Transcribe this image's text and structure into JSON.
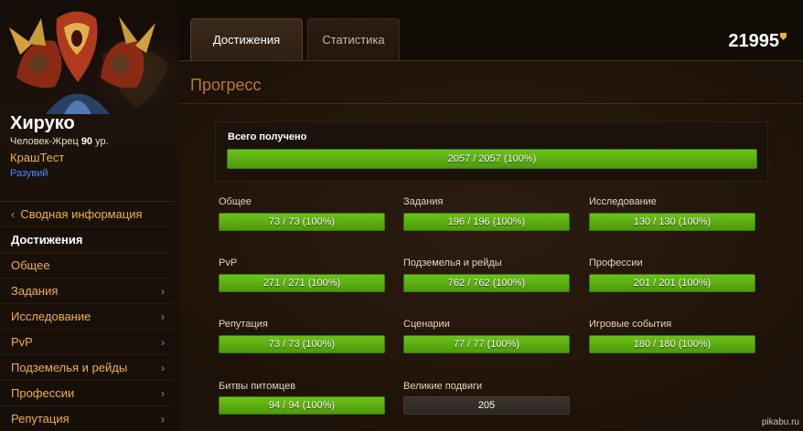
{
  "character": {
    "name": "Хируко",
    "race_class": "Человек-Жрец",
    "level": "90",
    "level_suffix": "ур.",
    "realm": "КрашТест",
    "guild": "Разувий"
  },
  "points": {
    "value": "21995",
    "icon": "shield-points-icon"
  },
  "tabs": [
    {
      "label": "Достижения",
      "active": true
    },
    {
      "label": "Статистика",
      "active": false
    }
  ],
  "sidebar": {
    "items": [
      {
        "label": "Сводная информация",
        "icon": "chevron-left-icon"
      },
      {
        "label": "Достижения",
        "active": true
      },
      {
        "label": "Общее"
      },
      {
        "label": "Задания",
        "icon": "chevron-right-icon"
      },
      {
        "label": "Исследование",
        "icon": "chevron-right-icon"
      },
      {
        "label": "PvP",
        "icon": "chevron-right-icon"
      },
      {
        "label": "Подземелья и рейды",
        "icon": "chevron-right-icon"
      },
      {
        "label": "Профессии",
        "icon": "chevron-right-icon"
      },
      {
        "label": "Репутация",
        "icon": "chevron-right-icon"
      }
    ]
  },
  "main": {
    "title": "Прогресс",
    "total": {
      "label": "Всего получено",
      "value": "2057 / 2057 (100%)",
      "progress": 1.0
    },
    "categories": [
      {
        "label": "Общее",
        "value": "73 / 73 (100%)",
        "progress": 1.0
      },
      {
        "label": "Задания",
        "value": "196 / 196 (100%)",
        "progress": 1.0
      },
      {
        "label": "Исследование",
        "value": "130 / 130 (100%)",
        "progress": 1.0
      },
      {
        "label": "PvP",
        "value": "271 / 271 (100%)",
        "progress": 1.0
      },
      {
        "label": "Подземелья и рейды",
        "value": "762 / 762 (100%)",
        "progress": 1.0
      },
      {
        "label": "Профессии",
        "value": "201 / 201 (100%)",
        "progress": 1.0
      },
      {
        "label": "Репутация",
        "value": "73 / 73 (100%)",
        "progress": 1.0
      },
      {
        "label": "Сценарии",
        "value": "77 / 77 (100%)",
        "progress": 1.0
      },
      {
        "label": "Игровые события",
        "value": "180 / 180 (100%)",
        "progress": 1.0
      },
      {
        "label": "Битвы питомцев",
        "value": "94 / 94 (100%)",
        "progress": 1.0
      },
      {
        "label": "Великие подвиги",
        "value": "205",
        "progress": 0
      }
    ]
  },
  "watermark": "pikabu.ru",
  "colors": {
    "accent_orange": "#f0b040",
    "progress_green": "#5aaa12",
    "guild_blue": "#3f8cff",
    "title_brown": "#b87a2a"
  }
}
